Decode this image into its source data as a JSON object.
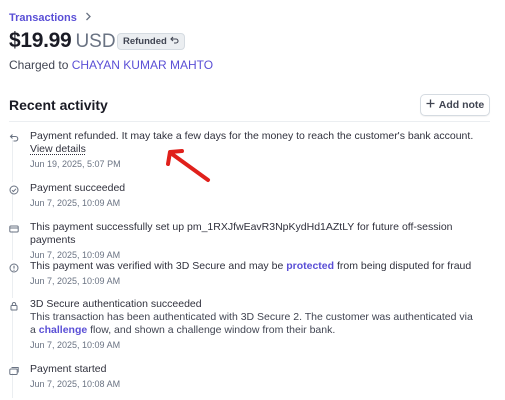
{
  "breadcrumb": {
    "label": "Transactions",
    "chevron": "chevron-right-icon"
  },
  "payment": {
    "amount": "$19.99",
    "currency": "USD",
    "status_badge": "Refunded",
    "charged_prefix": "Charged to",
    "customer": "CHAYAN KUMAR MAHTO"
  },
  "activity": {
    "title": "Recent activity",
    "add_note_label": "Add note",
    "events": [
      {
        "icon": "refund-icon",
        "title": "Payment refunded. It may take a few days for the money to reach the customer's bank account.",
        "link": "View details",
        "time": "Jun 19, 2025, 5:07 PM"
      },
      {
        "icon": "check-circle-icon",
        "title": "Payment succeeded",
        "time": "Jun 7, 2025, 10:09 AM"
      },
      {
        "icon": "card-icon",
        "title": "This payment successfully set up pm_1RXJfwEavR3NpKydHd1AZtLY for future off-session payments",
        "time": "Jun 7, 2025, 10:09 AM"
      },
      {
        "icon": "info-circle-icon",
        "title_before": "This payment was verified with 3D Secure and may be",
        "title_link": "protected",
        "title_after": "from being disputed for fraud",
        "time": "Jun 7, 2025, 10:09 AM"
      },
      {
        "icon": "lock-icon",
        "title": "3D Secure authentication succeeded",
        "desc_before": "This transaction has been authenticated with 3D Secure 2. The customer was authenticated via a",
        "desc_link": "challenge",
        "desc_after": "flow, and shown a challenge window from their bank.",
        "time": "Jun 7, 2025, 10:09 AM"
      },
      {
        "icon": "card-stack-icon",
        "title": "Payment started",
        "time": "Jun 7, 2025, 10:08 AM"
      }
    ]
  },
  "colors": {
    "accent": "#5a4fd6",
    "annotation_arrow": "#e0201b"
  }
}
